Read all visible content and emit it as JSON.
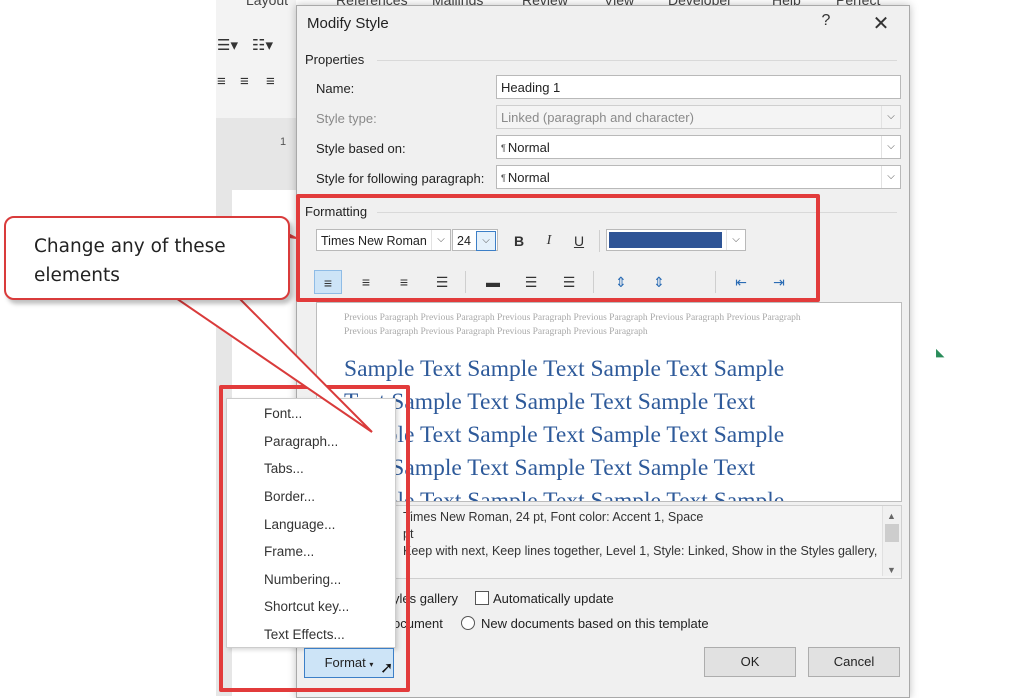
{
  "background": {
    "ribbon_tabs": [
      "Layout",
      "References",
      "Mailings",
      "Review",
      "View",
      "Developer",
      "Help",
      "Perfect"
    ],
    "ruler_marker": "1"
  },
  "dialog": {
    "title": "Modify Style",
    "help_label": "?",
    "close_label": "✕",
    "properties_header": "Properties",
    "name_label": "Name:",
    "name_value": "Heading 1",
    "style_type_label": "Style type:",
    "style_type_value": "Linked (paragraph and character)",
    "based_on_label": "Style based on:",
    "based_on_value": "Normal",
    "following_label": "Style for following paragraph:",
    "following_value": "Normal",
    "formatting_header": "Formatting",
    "font_name": "Times New Roman",
    "font_size": "24",
    "bold_label": "B",
    "italic_label": "I",
    "underline_label": "U",
    "font_color": "#2e5496",
    "preview_previous": "Previous Paragraph Previous Paragraph Previous Paragraph Previous Paragraph Previous Paragraph Previous Paragraph Previous Paragraph Previous Paragraph Previous Paragraph Previous Paragraph",
    "sample_lines": [
      "Sample Text Sample Text Sample Text Sample",
      "Text Sample Text Sample Text Sample Text",
      "Sample Text Sample Text Sample Text Sample",
      "Text Sample Text Sample Text Sample Text",
      "Sample Text Sample Text Sample Text Sample"
    ],
    "description_lines": [
      "Times New Roman, 24 pt, Font color: Accent 1, Space",
      "pt",
      "Keep with next, Keep lines together, Level 1, Style: Linked, Show in the Styles gallery,"
    ],
    "add_to_gallery_label": "yles gallery",
    "auto_update_label": "Automatically update",
    "only_doc_label": "ocument",
    "new_docs_label": "New documents based on this template",
    "ok_label": "OK",
    "cancel_label": "Cancel"
  },
  "format_menu": {
    "items": [
      "Font...",
      "Paragraph...",
      "Tabs...",
      "Border...",
      "Language...",
      "Frame...",
      "Numbering...",
      "Shortcut key...",
      "Text Effects..."
    ],
    "button_label": "Format"
  },
  "callout": {
    "line1": "Change any of these",
    "line2": "elements"
  },
  "colors": {
    "highlight_red": "#e23b3b",
    "sample_blue": "#2e5a9a"
  }
}
